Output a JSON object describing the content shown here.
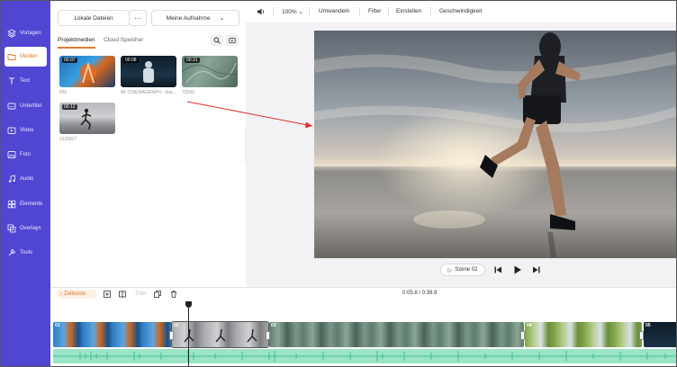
{
  "sidebar": {
    "items": [
      {
        "label": "Vorlagen",
        "icon": "layers-icon"
      },
      {
        "label": "Medien",
        "icon": "folder-icon",
        "active": true
      },
      {
        "label": "Text",
        "icon": "text-icon"
      },
      {
        "label": "Untertitel",
        "icon": "subtitle-icon"
      },
      {
        "label": "Video",
        "icon": "video-icon"
      },
      {
        "label": "Foto",
        "icon": "photo-icon"
      },
      {
        "label": "Audio",
        "icon": "music-icon"
      },
      {
        "label": "Elemente",
        "icon": "shapes-icon"
      },
      {
        "label": "Overlays",
        "icon": "overlay-icon"
      },
      {
        "label": "Tools",
        "icon": "tools-icon"
      }
    ]
  },
  "media_panel": {
    "local_files": "Lokale Dateien",
    "more": "···",
    "my_recording": "Meine Aufnahme",
    "tabs": [
      "Projektmedien",
      "Cloud Speicher"
    ],
    "items": [
      {
        "duration": "00:07",
        "caption": "655"
      },
      {
        "duration": "00:08",
        "caption": "4K CINEMAGRAPH - dea..."
      },
      {
        "duration": "00:31",
        "caption": "72566"
      },
      {
        "duration": "00:12",
        "caption": "3125827"
      }
    ]
  },
  "toolbar": {
    "zoom": "100%",
    "convert": "Umwandeln",
    "filter": "Filter",
    "settings": "Einstellen",
    "speed": "Geschwindigkeit"
  },
  "player": {
    "scene": "Szene 02"
  },
  "timeline": {
    "time_axis": "Zeitleiste",
    "trim": "Trim",
    "time": "0:05.8 / 0:39.9",
    "clips": [
      "01",
      "02",
      "03",
      "04",
      "05"
    ]
  },
  "colors": {
    "sidebar": "#5046d2",
    "accent": "#e07a2f",
    "audio": "#9be4c6",
    "annotation_arrow": "#e03030"
  }
}
